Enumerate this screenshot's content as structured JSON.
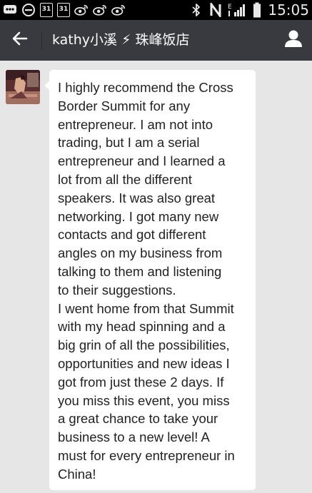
{
  "status_bar": {
    "calendar_day_1": "31",
    "calendar_day_2": "31",
    "network_type": "E",
    "time": "15:05"
  },
  "header": {
    "title": "kathy小溪 ⚡ 珠峰饭店"
  },
  "message": {
    "text": "I highly recommend the Cross\nBorder Summit for any\nentrepreneur. I am not into\ntrading, but I am a serial\nentrepreneur and I learned a\nlot from all the different\nspeakers. It was also great\nnetworking. I got many new\ncontacts and got different\nangles on my business from\ntalking to them and listening\nto their suggestions.\nI went home from that Summit\nwith my head spinning and a\nbig grin of all the possibilities,\nopportunities and new ideas I\ngot from just these 2 days. If\nyou miss this event, you miss\na great chance to take your\nbusiness to a new level! A\nmust for every entrepreneur in\nChina!"
  },
  "colors": {
    "status_bar_bg": "#000000",
    "title_bar_bg": "#393a3f",
    "chat_bg": "#e6e6e6",
    "bubble_bg": "#ffffff",
    "text": "#222222"
  },
  "icons": {
    "status_left": [
      "chat-dots-icon",
      "minus-circle-icon",
      "calendar-icon",
      "calendar-icon",
      "weibo-icon",
      "weibo-icon",
      "weibo-icon"
    ],
    "status_right": [
      "bluetooth-icon",
      "nfc-icon",
      "signal-icon",
      "battery-icon"
    ],
    "header": [
      "back-arrow-icon",
      "profile-icon"
    ]
  }
}
